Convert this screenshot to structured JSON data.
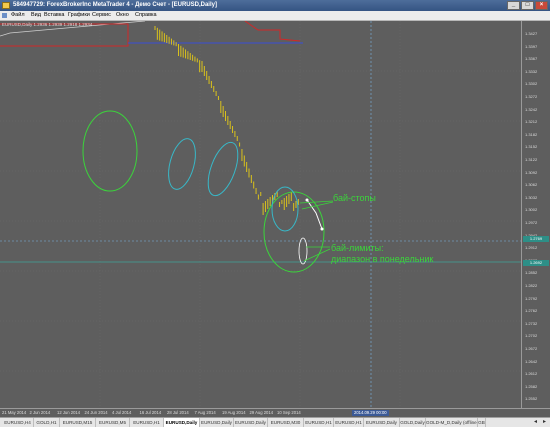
{
  "window": {
    "title": "584947729: ForexBrokerInc MetaTrader 4 - Демо Счет - [EURUSD,Daily]",
    "buttons": [
      "_",
      "□",
      "×"
    ]
  },
  "menu": [
    "Файл",
    "Вид",
    "Вставка",
    "Графики",
    "Сервис",
    "Окно",
    "Справка"
  ],
  "chart": {
    "symbol_info": "EURUSD,Daily  1.2936 1.2939 1.2918 1.2934",
    "annotations": {
      "buy_stops": "бай-стопы",
      "buy_limits_line1": "бай-лимиты:",
      "buy_limits_line2": "диапазон в понедельник"
    },
    "price_ticks": [
      "1.3427",
      "1.3397",
      "1.3367",
      "1.3332",
      "1.3302",
      "1.3272",
      "1.3242",
      "1.3212",
      "1.3182",
      "1.3152",
      "1.3122",
      "1.3092",
      "1.3062",
      "1.3032",
      "1.3002",
      "1.2972",
      "1.2942",
      "1.2912",
      "1.2882",
      "1.2852",
      "1.2822",
      "1.2792",
      "1.2762",
      "1.2732",
      "1.2702",
      "1.2672",
      "1.2642",
      "1.2612",
      "1.2582",
      "1.2552"
    ],
    "price_tags": [
      "1.2769",
      "1.2692"
    ],
    "date_ticks": [
      "21 May 2014",
      "2 Jun 2014",
      "12 Jun 2014",
      "24 Jun 2014",
      "4 Jul 2014",
      "16 Jul 2014",
      "28 Jul 2014",
      "7 Aug 2014",
      "19 Aug 2014",
      "29 Aug 2014",
      "10 Sep 2014"
    ],
    "date_highlight": "2014.09.29 00:00",
    "colors": {
      "background": "#5e5e5e",
      "candles": "#d9c11c",
      "annotation": "#3bd43b",
      "ellipse_green": "#3bd43b",
      "ellipse_cyan": "#38b8c8",
      "crosshair": "#7ab7e6",
      "hline_teal": "#3fa39b",
      "line_red": "#d02828",
      "line_blue": "#3a4fd6"
    }
  },
  "tabs": [
    "EURUSD,H4",
    "GOLD,H1",
    "EURUSD,M15",
    "EURUSD,M5",
    "EURUSD,H1",
    "EURUSD,Daily",
    "EURUSD,Daily",
    "EURUSD,Daily",
    "EURUSD,M30",
    "EURUSD,H1",
    "EURUSD,H1",
    "EURUSD,Daily",
    "GOLD,Daily",
    "GOLD-M_D,Daily (offline)",
    "GB"
  ],
  "active_tab": 5
}
